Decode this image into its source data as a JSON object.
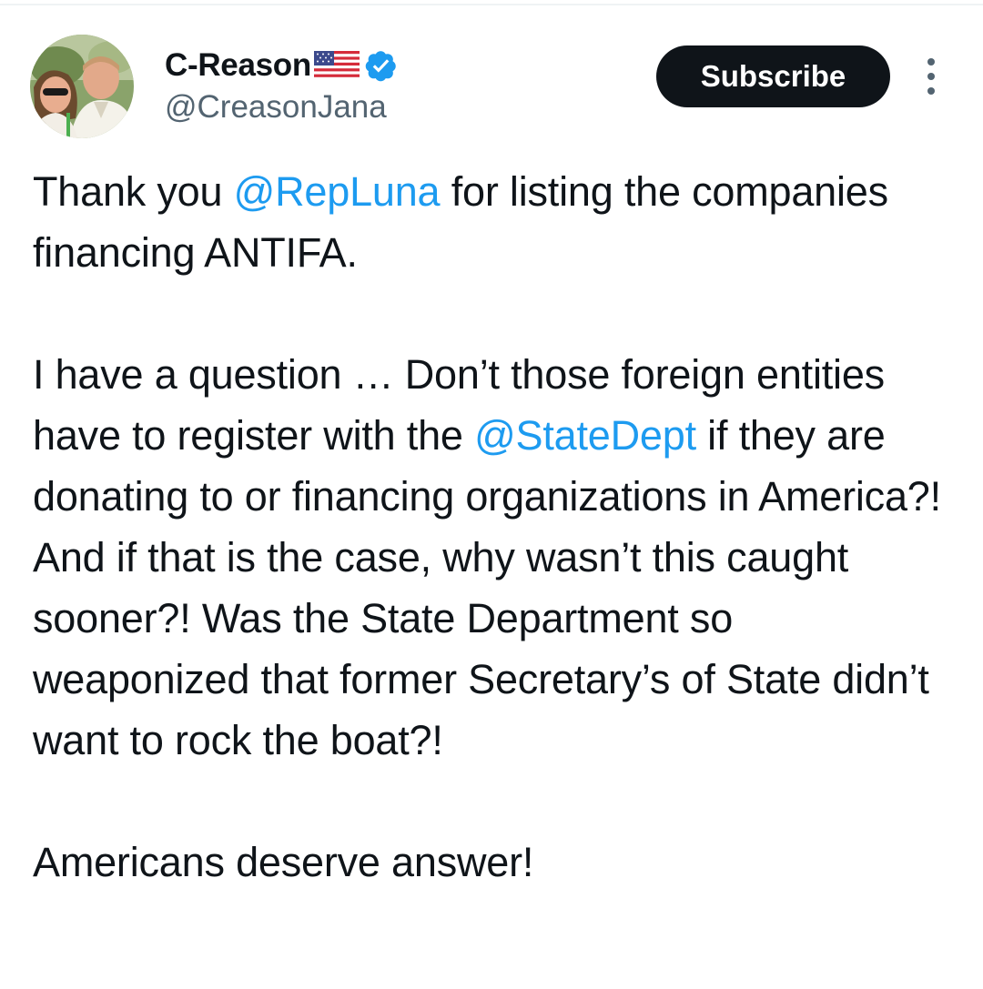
{
  "author": {
    "display_name": "C-Reason",
    "flag_icon": "us-flag-icon",
    "verified_icon": "verified-badge-icon",
    "handle": "@CreasonJana",
    "avatar_icon": "profile-photo",
    "verified_color": "#1d9bf0"
  },
  "actions": {
    "subscribe_label": "Subscribe",
    "more_icon": "vertical-ellipsis-icon"
  },
  "tweet": {
    "p1_a": "Thank you ",
    "p1_mention": "@RepLuna",
    "p1_b": " for listing the companies financing ANTIFA.",
    "p2_a": "I have a question … Don’t those foreign entities have to register with the ",
    "p2_mention": "@StateDept",
    "p2_b": " if they are donating to or financing organizations in America?! And if that is the case, why wasn’t this caught sooner?! Was the State Department so weaponized that former Secretary’s of State didn’t want to rock the boat?!",
    "p3": "Americans deserve answer!"
  },
  "colors": {
    "text": "#0f1419",
    "secondary_text": "#536471",
    "link": "#1d9bf0",
    "button_bg": "#0f1419",
    "button_text": "#ffffff"
  }
}
